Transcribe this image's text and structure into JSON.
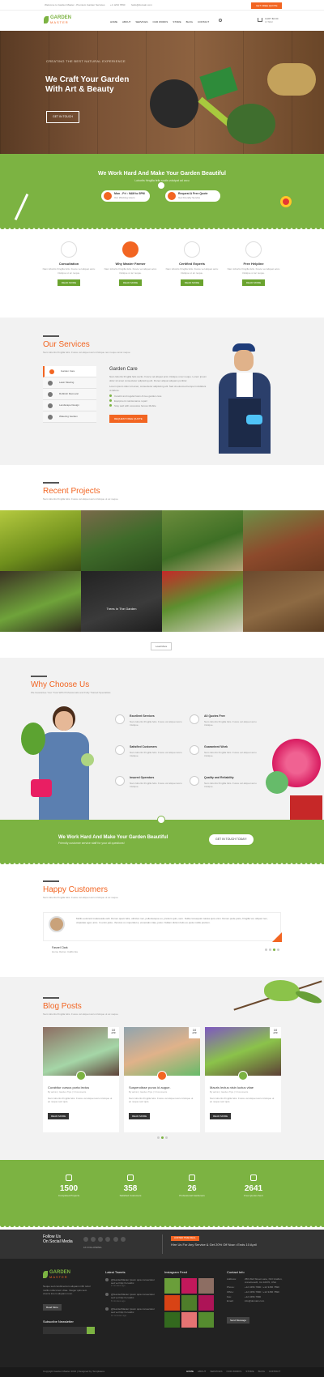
{
  "topbar": {
    "welcome": "Welcome to Garden Master - Premium Garden Services",
    "phone": "+1 1234 7890",
    "email": "hello@domain.com",
    "cta": "GET FREE QUOTE"
  },
  "header": {
    "logo_top": "GARDEN",
    "logo_bottom": "MASTER",
    "nav": [
      "HOME",
      "ABOUT",
      "SERVICES",
      "OUR WORKS",
      "STORE",
      "BLOG",
      "CONTACT"
    ],
    "cart_label": "CART",
    "cart_total": "$0.00",
    "cart_items": "0 ITEM"
  },
  "hero": {
    "kicker": "CREATING THE BEST NATURAL EXPERIENCE",
    "title_line1": "We Craft Your Garden",
    "title_line2": "With Art & Beauty",
    "button": "GET IN TOUCH"
  },
  "banner": {
    "title": "We Work Hard And Make Your Garden Beautiful",
    "subtitle": "Lobortis fringilla felis sociis volutpat ad arcu",
    "pill1_title": "Mon - Fri : 9AM to 5PM",
    "pill1_sub": "Our Working Hours",
    "pill2_title": "Request A Free Quote",
    "pill2_sub": "Get Friendly Service"
  },
  "features": [
    {
      "title": "Consultation",
      "text": "Nam lobortis fringilla felis. Fusce vel aliquet accu tristique ut ac neque.",
      "button": "READ MORE"
    },
    {
      "title": "Why Master Farmer",
      "text": "Nam lobortis fringilla felis. Fusce vel aliquet accu tristique ut ac neque.",
      "button": "READ MORE"
    },
    {
      "title": "Certified Experts",
      "text": "Nam lobortis fringilla felis. Fusce vel aliquet accu tristique ut ac neque.",
      "button": "READ MORE"
    },
    {
      "title": "Free Helpline",
      "text": "Nam lobortis fringilla felis. Fusce vel aliquet accu tristique ut ac neque.",
      "button": "READ MORE"
    }
  ],
  "services": {
    "title": "Our Services",
    "subtitle": "Nam lobortis fringilla felis. Fusce vel aliquet accu tristique nec neque amet neque.",
    "tabs": [
      "Garden Care",
      "Lawn Mowing",
      "Rubbish Removal",
      "Landscape Design",
      "Watering Garden"
    ],
    "active_title": "Garden Care",
    "para1": "Nam lobortis fringilla felis sociis. Fusce vel aliquet accu tristique ut ac neque. Lorem ipsum dolor sit amet consectetur adipiscing elit. Donec aliquet aliquam porttitor.",
    "para2": "Lorem ipsum dolor sit amet, consectetur adipiscing elit. Sed do eiusmod tempor incididunt ut labore.",
    "bullets": [
      "Careful and regular lawn & tree garden care",
      "Equipment maintenance repair",
      "Stay well with excessive fences Mobile"
    ],
    "button": "REQUEST FREE QUOTE"
  },
  "projects": {
    "title": "Recent Projects",
    "subtitle": "Nam lobortis fringilla felis. Fusce vel aliquet accu tristique ut ac neque.",
    "caption": "Trees In The Garden",
    "button": "Load More"
  },
  "why": {
    "title": "Why Choose Us",
    "subtitle": "We Guarantee Your Trust With Professionals and Fully Trained Specialists",
    "items": [
      {
        "title": "Excellent Services",
        "text": "Nam lobortis fringilla felis. Fusce vel aliquet accu tristique."
      },
      {
        "title": "All Quotes Free",
        "text": "Nam lobortis fringilla felis. Fusce vel aliquet accu tristique."
      },
      {
        "title": "Satisfied Customers",
        "text": "Nam lobortis fringilla felis. Fusce vel aliquet accu tristique."
      },
      {
        "title": "Guaranteed Work",
        "text": "Nam lobortis fringilla felis. Fusce vel aliquet accu tristique."
      },
      {
        "title": "Insured Operators",
        "text": "Nam lobortis fringilla felis. Fusce vel aliquet accu tristique."
      },
      {
        "title": "Quality and Reliability",
        "text": "Nam lobortis fringilla felis. Fusce vel aliquet accu tristique."
      }
    ]
  },
  "cta": {
    "title": "We Work Hard And Make Your Garden Beautiful",
    "subtitle": "Friendly customer service staff for your all questions!",
    "button": "GET IN TOUCH TODAY!"
  },
  "testimonials": {
    "title": "Happy Customers",
    "subtitle": "Nam lobortis fringilla felis. Fusce vel aliquet accu tristique ut ac neque.",
    "quote": "Mollis euismod malesuada velit. Donec quam felis, ultricies nec, pellentesque eu, pretium quis, sem. Nulla consequat massa quis enim. Donec pede justo, fringilla vel, aliquet nec, vulputate eget, arcu. In enim justo, rhoncus ut, imperdiet a, venenatis vitae, justo. Nullam dictum felis eu pede mollis pretium.",
    "name": "Fasnel Clark",
    "role": "Home Owner, California"
  },
  "blog": {
    "title": "Blog Posts",
    "subtitle": "Nam lobortis fringilla felis. Fusce vel aliquet accu tristique ut ac neque.",
    "posts": [
      {
        "day": "10",
        "month": "APR",
        "title": "Curabitur cursus porta lectus",
        "meta": "By admin  |  Garden Tips  |  3 Comments",
        "text": "Nam lobortis fringilla felis. Fusce vel aliquet accu tristique ut ac neque sed quis.",
        "button": "READ MORE"
      },
      {
        "day": "10",
        "month": "APR",
        "title": "Suspendisse purus id augue.",
        "meta": "By admin  |  Garden Tips  |  3 Comments",
        "text": "Nam lobortis fringilla felis. Fusce vel aliquet accu tristique ut ac neque sed quis.",
        "button": "READ MORE"
      },
      {
        "day": "10",
        "month": "APR",
        "title": "Mauris lectus nisin luctus vitae",
        "meta": "By admin  |  Garden Tips  |  3 Comments",
        "text": "Nam lobortis fringilla felis. Fusce vel aliquet accu tristique ut ac neque sed quis.",
        "button": "READ MORE"
      }
    ]
  },
  "stats": [
    {
      "value": "1500",
      "label": "Completed Projects"
    },
    {
      "value": "358",
      "label": "Satisfied Customers"
    },
    {
      "value": "26",
      "label": "Professional Gardeners"
    },
    {
      "value": "2641",
      "label": "Free Quotes Sent"
    }
  ],
  "social": {
    "title_line1": "Follow Us",
    "title_line2": "On Social Media",
    "followers": "1K FOLLOWING",
    "promo_badge": "LIMITED TIME DEAL",
    "promo": "Hire Us For Any Service & Get 20% Off Now • Ends 10 April"
  },
  "footer": {
    "logo_top": "GARDEN",
    "logo_bottom": "MASTER",
    "about": "Neque sed condimentum aliquam nibh tortor mollis nulla lorem vitae. Integer quis sem viverra lorem aliquam nunc.",
    "about_button": "Read More",
    "newsletter_title": "Subscribe Newsletter",
    "tweets_title": "Latest Tweets",
    "tweets": [
      {
        "text": "@GardenMaster ipsum quia consectetur sed vel http://t.co/abc",
        "time": "2 minutes ago"
      },
      {
        "text": "@GardenMaster ipsum quia consectetur sed vel http://t.co/abc",
        "time": "8 minutes ago"
      },
      {
        "text": "@GardenMaster ipsum quia consectetur sed vel http://t.co/abc",
        "time": "12 minutes ago"
      }
    ],
    "instagram_title": "Instagram Feed",
    "contact_title": "Contact Info",
    "contact": [
      {
        "label": "Address:",
        "value": "256 Well Street Lane, NCI Grafton, AnnaCanoR, CA 10970, USA"
      },
      {
        "label": "Phone:",
        "value": "+12 3456 7890 / +12 3456 7890"
      },
      {
        "label": "Office:",
        "value": "+12 3456 7890 / +12 3456 7890"
      },
      {
        "label": "Fax:",
        "value": "+12 3456 7890"
      },
      {
        "label": "Email:",
        "value": "info@domain.com"
      }
    ],
    "contact_button": "Send Message",
    "copyright": "Copyright Garden Master 2016 | Designed by Templatera",
    "nav": [
      "HOME",
      "ABOUT",
      "SERVICES",
      "OUR WORKS",
      "STORE",
      "BLOG",
      "CONTACT"
    ]
  },
  "colors": {
    "green": "#7cb342",
    "orange": "#f26522",
    "dark": "#2b2b2b"
  }
}
